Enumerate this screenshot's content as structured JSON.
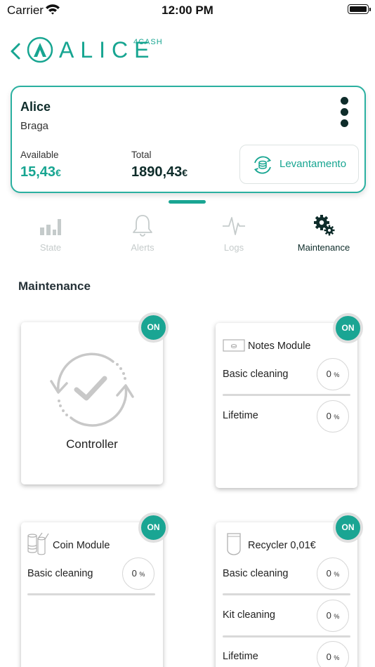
{
  "status_bar": {
    "carrier": "Carrier",
    "time": "12:00 PM"
  },
  "header": {
    "logo_text": "ALICE",
    "logo_superscript": "4CASH"
  },
  "account": {
    "name": "Alice",
    "city": "Braga",
    "available_label": "Available",
    "available_value": "15,43",
    "total_label": "Total",
    "total_value": "1890,43",
    "currency": "€",
    "withdraw_label": "Levantamento"
  },
  "tabs": [
    {
      "label": "State",
      "icon": "bar-chart-icon",
      "active": false
    },
    {
      "label": "Alerts",
      "icon": "bell-icon",
      "active": false
    },
    {
      "label": "Logs",
      "icon": "pulse-icon",
      "active": false
    },
    {
      "label": "Maintenance",
      "icon": "gears-icon",
      "active": true
    }
  ],
  "section_title": "Maintenance",
  "modules": {
    "controller": {
      "title": "Controller",
      "status": "ON",
      "icon": "sync-check-icon"
    },
    "notes": {
      "title": "Notes Module",
      "status": "ON",
      "icon": "banknote-icon",
      "rows": [
        {
          "label": "Basic cleaning",
          "value": "0",
          "unit": "%"
        },
        {
          "label": "Lifetime",
          "value": "0",
          "unit": "%"
        }
      ]
    },
    "coin": {
      "title": "Coin Module",
      "status": "ON",
      "icon": "coin-tubes-icon",
      "rows": [
        {
          "label": "Basic cleaning",
          "value": "0",
          "unit": "%"
        }
      ]
    },
    "recycler": {
      "title": "Recycler 0,01€",
      "status": "ON",
      "icon": "recycler-cup-icon",
      "rows": [
        {
          "label": "Basic cleaning",
          "value": "0",
          "unit": "%"
        },
        {
          "label": "Kit cleaning",
          "value": "0",
          "unit": "%"
        },
        {
          "label": "Lifetime",
          "value": "0",
          "unit": "%"
        }
      ]
    }
  },
  "colors": {
    "accent": "#1aa593",
    "dark": "#0e2c2a",
    "inactive": "#c5cbcb"
  }
}
